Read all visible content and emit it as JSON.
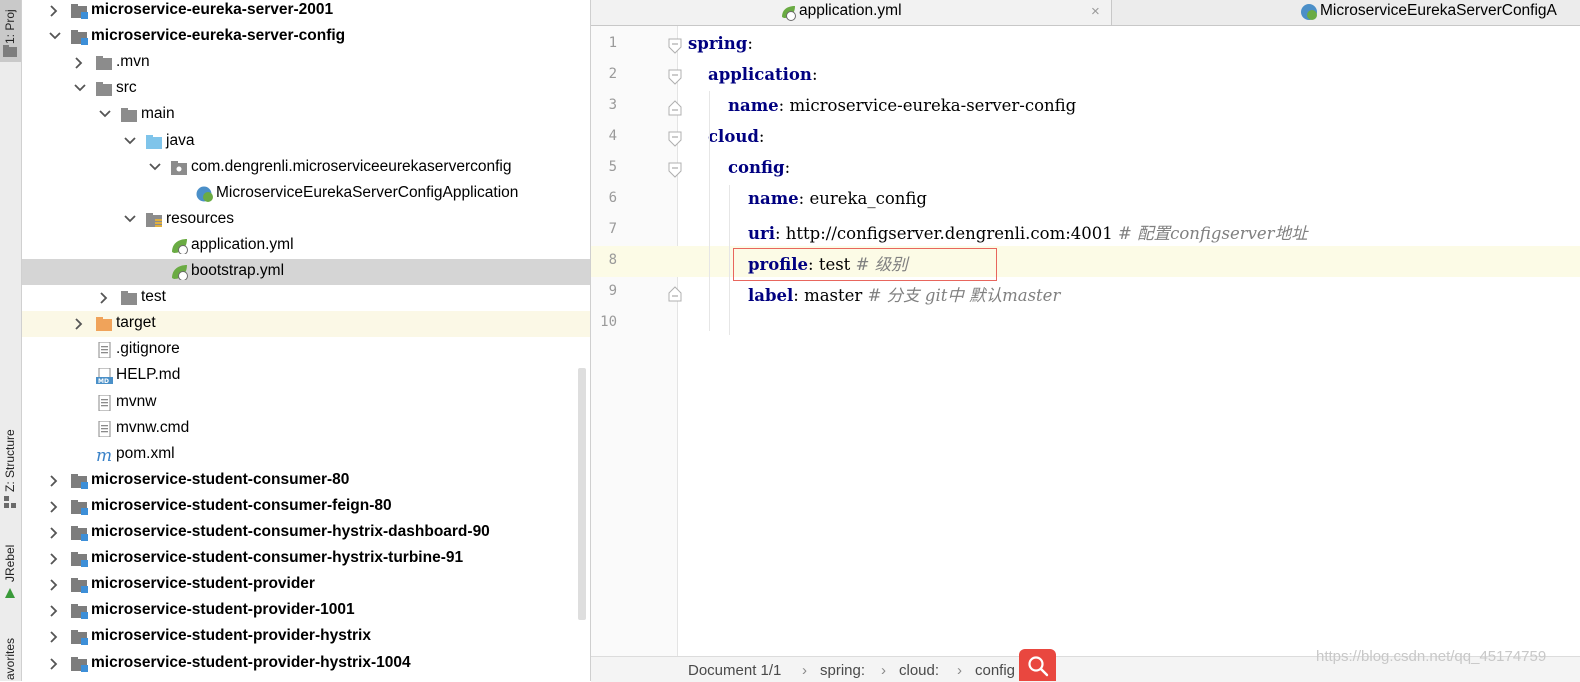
{
  "tool_strip": {
    "project_tab": "1: Proj",
    "structure_tab": "Z: Structure",
    "jrebel_tab": "JRebel",
    "favorites_tab": "avorites"
  },
  "tree": [
    {
      "label": "microservice-eureka-server-2001",
      "bold": true,
      "arrow": "right",
      "icon": "module-folder-icon",
      "indent": 0
    },
    {
      "label": "microservice-eureka-server-config",
      "bold": true,
      "arrow": "down",
      "icon": "module-folder-icon",
      "indent": 0
    },
    {
      "label": ".mvn",
      "bold": false,
      "arrow": "right",
      "icon": "folder-icon",
      "indent": 1
    },
    {
      "label": "src",
      "bold": false,
      "arrow": "down",
      "icon": "folder-icon",
      "indent": 1
    },
    {
      "label": "main",
      "bold": false,
      "arrow": "down",
      "icon": "folder-icon",
      "indent": 2
    },
    {
      "label": "java",
      "bold": false,
      "arrow": "down",
      "icon": "source-folder-icon",
      "indent": 3
    },
    {
      "label": "com.dengrenli.microserviceeurekaserverconfig",
      "bold": false,
      "arrow": "down",
      "icon": "package-icon",
      "indent": 4
    },
    {
      "label": "MicroserviceEurekaServerConfigApplication",
      "bold": false,
      "arrow": "none",
      "icon": "spring-boot-class-icon",
      "indent": 5
    },
    {
      "label": "resources",
      "bold": false,
      "arrow": "down",
      "icon": "resources-folder-icon",
      "indent": 3
    },
    {
      "label": "application.yml",
      "bold": false,
      "arrow": "none",
      "icon": "spring-yml-icon",
      "indent": 4
    },
    {
      "label": "bootstrap.yml",
      "bold": false,
      "arrow": "none",
      "icon": "spring-yml-icon",
      "indent": 4,
      "selected": true
    },
    {
      "label": "test",
      "bold": false,
      "arrow": "right",
      "icon": "folder-icon",
      "indent": 2
    },
    {
      "label": "target",
      "bold": false,
      "arrow": "right",
      "icon": "excluded-folder-icon",
      "indent": 1,
      "highlighted": true
    },
    {
      "label": ".gitignore",
      "bold": false,
      "arrow": "none",
      "icon": "text-file-icon",
      "indent": 1
    },
    {
      "label": "HELP.md",
      "bold": false,
      "arrow": "none",
      "icon": "markdown-file-icon",
      "indent": 1
    },
    {
      "label": "mvnw",
      "bold": false,
      "arrow": "none",
      "icon": "text-file-icon",
      "indent": 1
    },
    {
      "label": "mvnw.cmd",
      "bold": false,
      "arrow": "none",
      "icon": "text-file-icon",
      "indent": 1
    },
    {
      "label": "pom.xml",
      "bold": false,
      "arrow": "none",
      "icon": "maven-icon",
      "indent": 1
    },
    {
      "label": "microservice-student-consumer-80",
      "bold": true,
      "arrow": "right",
      "icon": "module-folder-icon",
      "indent": 0
    },
    {
      "label": "microservice-student-consumer-feign-80",
      "bold": true,
      "arrow": "right",
      "icon": "module-folder-icon",
      "indent": 0
    },
    {
      "label": "microservice-student-consumer-hystrix-dashboard-90",
      "bold": true,
      "arrow": "right",
      "icon": "module-folder-icon",
      "indent": 0
    },
    {
      "label": "microservice-student-consumer-hystrix-turbine-91",
      "bold": true,
      "arrow": "right",
      "icon": "module-folder-icon",
      "indent": 0
    },
    {
      "label": "microservice-student-provider",
      "bold": true,
      "arrow": "right",
      "icon": "module-folder-icon",
      "indent": 0
    },
    {
      "label": "microservice-student-provider-1001",
      "bold": true,
      "arrow": "right",
      "icon": "module-folder-icon",
      "indent": 0
    },
    {
      "label": "microservice-student-provider-hystrix",
      "bold": true,
      "arrow": "right",
      "icon": "module-folder-icon",
      "indent": 0
    },
    {
      "label": "microservice-student-provider-hystrix-1004",
      "bold": true,
      "arrow": "right",
      "icon": "module-folder-icon",
      "indent": 0
    }
  ],
  "editor": {
    "tabs": [
      {
        "label": "application.yml",
        "close": "×"
      },
      {
        "label": "MicroserviceEurekaServerConfigA"
      }
    ],
    "lines": [
      {
        "num": "1",
        "key": "spring",
        "value": "",
        "comment": "",
        "indent": 0
      },
      {
        "num": "2",
        "key": "application",
        "value": "",
        "comment": "",
        "indent": 1
      },
      {
        "num": "3",
        "key": "name",
        "value": "microservice-eureka-server-config",
        "comment": "",
        "indent": 2
      },
      {
        "num": "4",
        "key": "cloud",
        "value": "",
        "comment": "",
        "indent": 1
      },
      {
        "num": "5",
        "key": "config",
        "value": "",
        "comment": "",
        "indent": 2
      },
      {
        "num": "6",
        "key": "name",
        "value": "eureka_config",
        "comment": "",
        "indent": 3
      },
      {
        "num": "7",
        "key": "uri",
        "value": "http://configserver.dengrenli.com:4001",
        "comment": "# 配置configserver地址",
        "indent": 3
      },
      {
        "num": "8",
        "key": "profile",
        "value": "test",
        "comment": "# 级别",
        "indent": 3,
        "current": true
      },
      {
        "num": "9",
        "key": "label",
        "value": "master",
        "comment": "# 分支 git中 默认master",
        "indent": 3
      },
      {
        "num": "10",
        "key": "",
        "value": "",
        "comment": "",
        "indent": 0
      }
    ]
  },
  "status_bar": {
    "crumbs": [
      "Document 1/1",
      "spring:",
      "cloud:",
      "config"
    ],
    "separator": "›"
  },
  "watermark": "https://blog.csdn.net/qq_45174759",
  "colors": {
    "key": "#000080",
    "comment": "#808080",
    "highlight_box": "#e8665d",
    "search_button": "#e9473f"
  }
}
